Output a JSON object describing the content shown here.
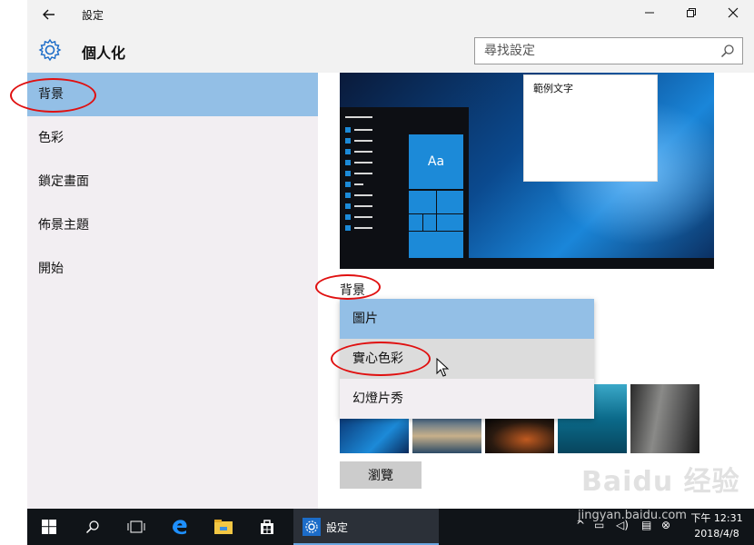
{
  "titlebar": {
    "title": "設定",
    "back_icon": "arrow-left-icon",
    "minimize_icon": "minimize-icon",
    "maximize_icon": "maximize-icon",
    "close_icon": "close-icon"
  },
  "header": {
    "icon": "gear-icon",
    "title": "個人化",
    "search_placeholder": "尋找設定"
  },
  "sidebar": {
    "items": [
      {
        "label": "背景",
        "selected": true
      },
      {
        "label": "色彩",
        "selected": false
      },
      {
        "label": "鎖定畫面",
        "selected": false
      },
      {
        "label": "佈景主題",
        "selected": false
      },
      {
        "label": "開始",
        "selected": false
      }
    ]
  },
  "preview": {
    "sample_text": "範例文字",
    "tile_label": "Aa"
  },
  "background": {
    "label": "背景",
    "options": [
      "圖片",
      "實心色彩",
      "幻燈片秀"
    ],
    "selected": "圖片",
    "hovered": "實心色彩",
    "browse_label": "瀏覽"
  },
  "taskbar": {
    "start_icon": "windows-start-icon",
    "search_icon": "search-icon",
    "taskview_icon": "task-view-icon",
    "edge_icon": "edge-icon",
    "explorer_icon": "file-explorer-icon",
    "store_icon": "store-icon",
    "active_app_label": "設定",
    "time": "下午 12:31",
    "date": "2018/4/8"
  },
  "watermark": {
    "brand": "Baidu 经验",
    "url": "jingyan.baidu.com"
  },
  "colors": {
    "accent": "#1c8ad8",
    "selection": "#93bfe6",
    "annotation": "#e01010"
  }
}
